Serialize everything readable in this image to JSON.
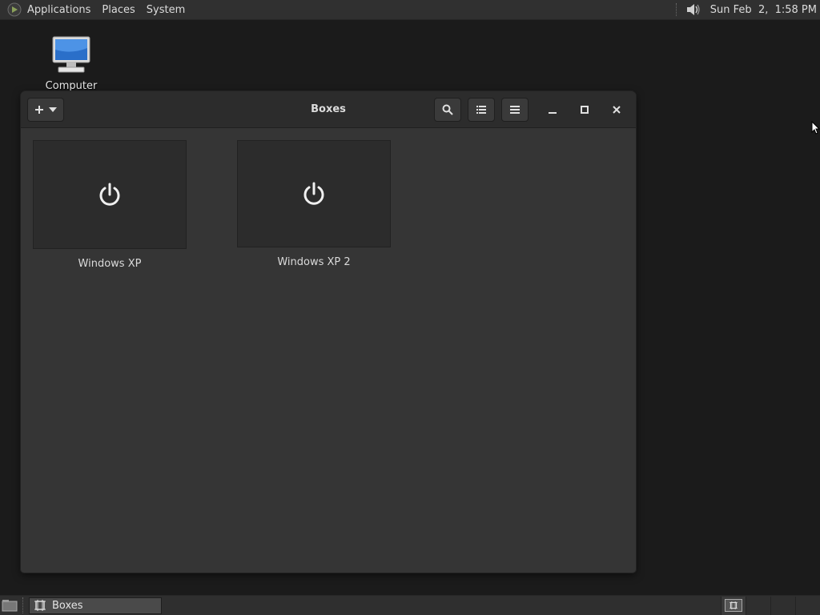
{
  "top_panel": {
    "menus": [
      "Applications",
      "Places",
      "System"
    ],
    "clock": "Sun Feb  2,  1:58 PM",
    "icons": {
      "app_logo": "gnome-foot-icon",
      "volume": "speaker-icon"
    }
  },
  "desktop": {
    "icons": [
      {
        "label": "Computer",
        "icon": "computer-monitor-icon"
      }
    ]
  },
  "window": {
    "title": "Boxes",
    "headerbar": {
      "new_button": {
        "icons": [
          "plus-icon",
          "chevron-down-icon"
        ]
      },
      "search_button": "search-icon",
      "list_view_button": "list-view-icon",
      "menu_button": "hamburger-menu-icon",
      "controls": [
        "minimize-icon",
        "maximize-icon",
        "close-icon"
      ]
    },
    "boxes": [
      {
        "label": "Windows XP",
        "icon": "power-icon"
      },
      {
        "label": "Windows XP 2",
        "icon": "power-icon"
      }
    ]
  },
  "bottom_panel": {
    "tasks": [
      {
        "label": "Boxes",
        "icon": "boxes-app-icon"
      }
    ],
    "workspaces": 4
  },
  "colors": {
    "desktop_bg": "#1b1b1b",
    "window_bg": "#353535",
    "headerbar_bg": "#2c2c2c",
    "panel_bg": "#303030"
  }
}
